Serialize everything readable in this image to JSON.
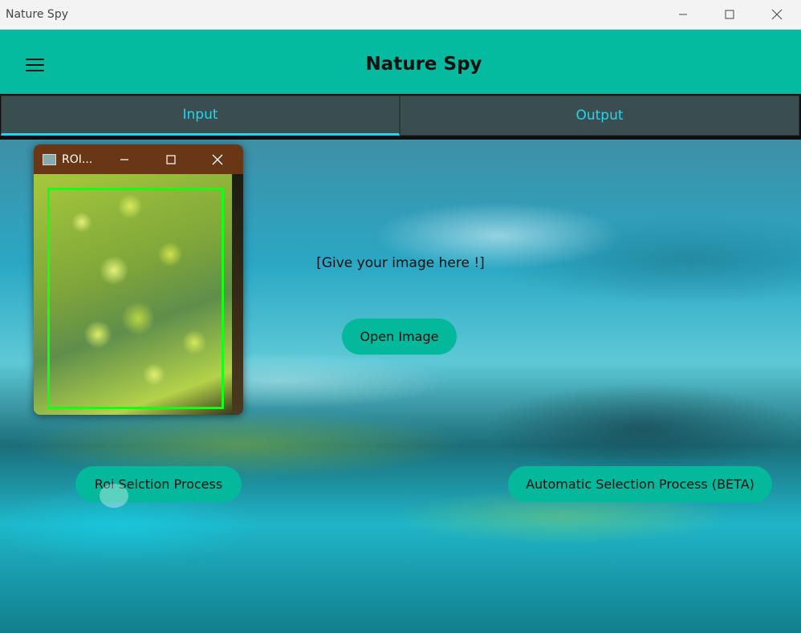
{
  "window": {
    "title": "Nature Spy"
  },
  "appbar": {
    "title": "Nature Spy"
  },
  "tabs": [
    {
      "label": "Input",
      "active": true
    },
    {
      "label": "Output",
      "active": false
    }
  ],
  "main": {
    "prompt": "[Give your image here !]",
    "open_button": "Open Image",
    "roi_button": "Roi Selction Process",
    "auto_button": "Automatic Selection Process (BETA)"
  },
  "roi_window": {
    "title": "ROI..."
  },
  "colors": {
    "accent": "#05bb9f",
    "tab_text": "#22d6f0",
    "tab_bg": "#3a4e50",
    "roi_box": "#13ff13",
    "roi_titlebar": "#6a3716"
  },
  "icons": [
    "menu-icon",
    "minimize-icon",
    "maximize-icon",
    "close-icon",
    "app-icon"
  ]
}
